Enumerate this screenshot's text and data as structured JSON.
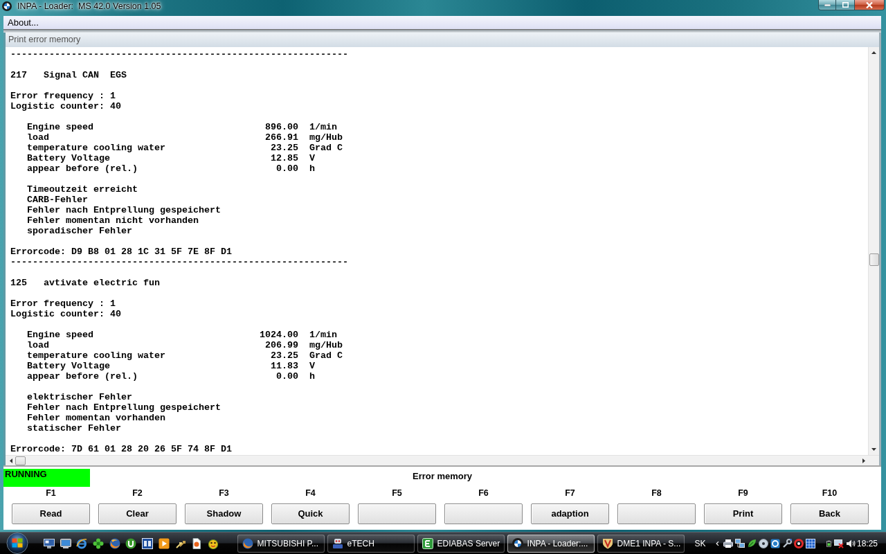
{
  "window": {
    "title": "INPA - Loader:  MS 42.0 Version 1.05"
  },
  "menu": [
    "About..."
  ],
  "report": {
    "title": "Print error memory",
    "entries": [
      {
        "separator": "-------------------------------------------------------------",
        "number": "217",
        "name": "Signal CAN  EGS",
        "stats": [
          "Error frequency : 1",
          "Logistic counter: 40"
        ],
        "measurements": [
          {
            "label": "Engine speed",
            "value": "896.00",
            "unit": "1/min"
          },
          {
            "label": "load",
            "value": "266.91",
            "unit": "mg/Hub"
          },
          {
            "label": "temperature cooling water",
            "value": "23.25",
            "unit": "Grad C"
          },
          {
            "label": "Battery Voltage",
            "value": "12.85",
            "unit": "V"
          },
          {
            "label": "appear before (rel.)",
            "value": "0.00",
            "unit": "h"
          }
        ],
        "conditions": [
          "Timeoutzeit erreicht",
          "CARB-Fehler",
          "Fehler nach Entprellung gespeichert",
          "Fehler momentan nicht vorhanden",
          "sporadischer Fehler"
        ],
        "errorcode": "Errorcode: D9 B8 01 28 1C 31 5F 7E 8F D1"
      },
      {
        "separator": "-------------------------------------------------------------",
        "number": "125",
        "name": "avtivate electric fun",
        "stats": [
          "Error frequency : 1",
          "Logistic counter: 40"
        ],
        "measurements": [
          {
            "label": "Engine speed",
            "value": "1024.00",
            "unit": "1/min"
          },
          {
            "label": "load",
            "value": "206.99",
            "unit": "mg/Hub"
          },
          {
            "label": "temperature cooling water",
            "value": "23.25",
            "unit": "Grad C"
          },
          {
            "label": "Battery Voltage",
            "value": "11.83",
            "unit": "V"
          },
          {
            "label": "appear before (rel.)",
            "value": "0.00",
            "unit": "h"
          }
        ],
        "conditions": [
          "elektrischer Fehler",
          "Fehler nach Entprellung gespeichert",
          "Fehler momentan vorhanden",
          "statischer Fehler"
        ],
        "errorcode": "Errorcode: 7D 61 01 28 20 26 5F 74 8F D1"
      }
    ]
  },
  "status": {
    "state": "RUNNING",
    "title": "Error memory"
  },
  "function_keys": [
    {
      "key": "F1",
      "label": "Read"
    },
    {
      "key": "F2",
      "label": "Clear"
    },
    {
      "key": "F3",
      "label": "Shadow"
    },
    {
      "key": "F4",
      "label": "Quick"
    },
    {
      "key": "F5"
    },
    {
      "key": "F6"
    },
    {
      "key": "F7",
      "label": "adaption"
    },
    {
      "key": "F8"
    },
    {
      "key": "F9",
      "label": "Print"
    },
    {
      "key": "F10",
      "label": "Back"
    }
  ],
  "taskbar": {
    "tasks": [
      {
        "label": "MITSUBISHI P...",
        "selected": false
      },
      {
        "label": "eTECH",
        "selected": false
      },
      {
        "label": "EDIABAS Server",
        "selected": false
      },
      {
        "label": "INPA - Loader:...",
        "selected": true
      },
      {
        "label": "DME1 INPA - S...",
        "selected": false
      }
    ],
    "language": "SK",
    "clock": "18:25"
  }
}
